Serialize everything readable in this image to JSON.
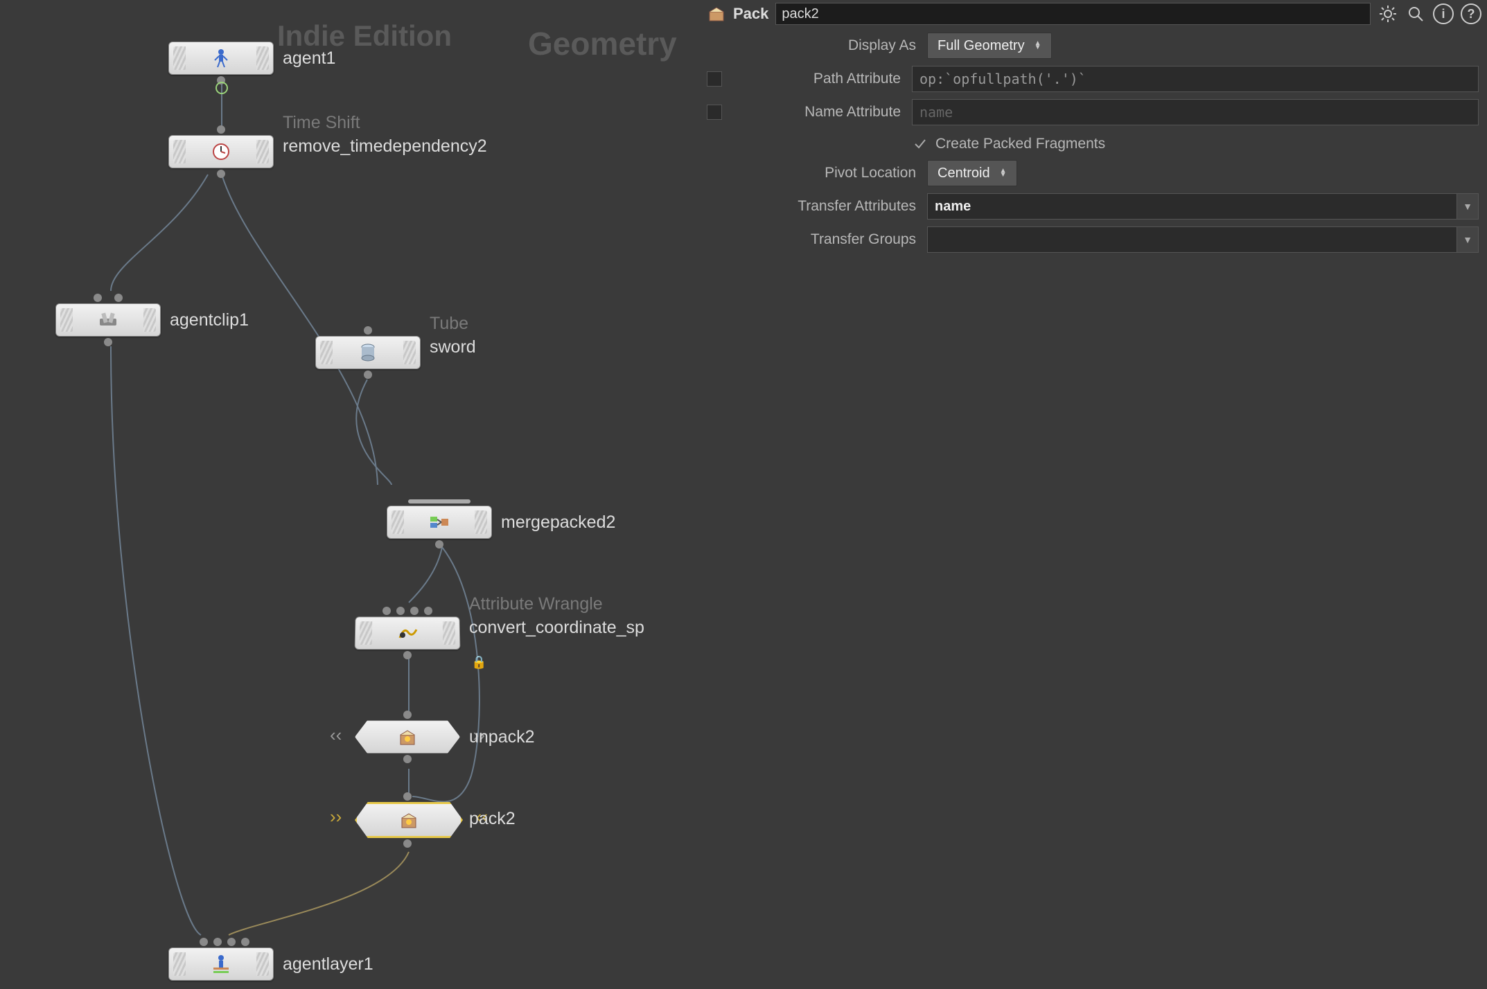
{
  "watermarks": {
    "indie": "Indie Edition",
    "geometry": "Geometry"
  },
  "nodes": {
    "agent1": {
      "type": "",
      "label": "agent1"
    },
    "timeshift": {
      "type": "Time Shift",
      "label": "remove_timedependency2"
    },
    "agentclip1": {
      "type": "",
      "label": "agentclip1"
    },
    "tube": {
      "type": "Tube",
      "label": "sword"
    },
    "merge": {
      "type": "",
      "label": "mergepacked2"
    },
    "wrangle": {
      "type": "Attribute Wrangle",
      "label": "convert_coordinate_sp"
    },
    "unpack": {
      "type": "",
      "label": "unpack2"
    },
    "pack": {
      "type": "",
      "label": "pack2"
    },
    "agentlayer": {
      "type": "",
      "label": "agentlayer1"
    }
  },
  "panel": {
    "op_type": "Pack",
    "op_name": "pack2",
    "params": {
      "display_as": {
        "label": "Display As",
        "value": "Full Geometry"
      },
      "path_attr": {
        "label": "Path Attribute",
        "value": "op:`opfullpath('.')`"
      },
      "name_attr": {
        "label": "Name Attribute",
        "placeholder": "name"
      },
      "create_frag": {
        "label": "Create Packed Fragments"
      },
      "pivot": {
        "label": "Pivot Location",
        "value": "Centroid"
      },
      "xfer_attr": {
        "label": "Transfer Attributes",
        "value": "name"
      },
      "xfer_grp": {
        "label": "Transfer Groups",
        "value": ""
      }
    }
  }
}
